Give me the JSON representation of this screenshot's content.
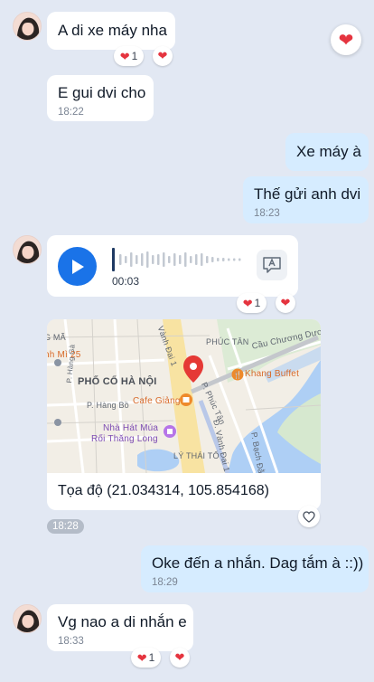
{
  "messages": {
    "m1": {
      "text": "A di xe máy nha",
      "reaction_count": "1"
    },
    "m2": {
      "text": "E gui dvi cho",
      "time": "18:22"
    },
    "m3": {
      "text": "Xe máy à"
    },
    "m4": {
      "text": "Thế gửi anh dvi",
      "time": "18:23"
    },
    "voice": {
      "duration": "00:03",
      "reaction_count": "1"
    },
    "location": {
      "caption": "Tọa độ (21.034314, 105.854168)",
      "time": "18:28"
    },
    "m5": {
      "text": "Oke đến a nhắn. Dag tắm à ::))",
      "time": "18:29"
    },
    "m6": {
      "text": "Vg nao a di nhắn e",
      "time": "18:33",
      "reaction_count": "1"
    }
  },
  "map": {
    "labels": {
      "vanh_dai_1": "Vành Đai 1",
      "phuc_tan": "PHÚC TÂN",
      "cau_chuong_duong": "Cầu Chương Dươn",
      "ma": "G MÃ",
      "mi25": "nh Mì 25",
      "pho_co": "PHỐ CỔ HÀ NỘI",
      "khang_buffet": "Khang Buffet",
      "p_hang_ga": "P. Hàng Gà",
      "p_hang_bo": "P. Hàng Bồ",
      "cafe_giang": "Cafe Giảng",
      "p_phuc_tan": "P. Phúc Tân",
      "nha_hat_1": "Nhà Hát Múa",
      "nha_hat_2": "Rối Thăng Long",
      "d_vanh_dai_1": "Đ. Vành Đai 1",
      "ly_thai_to": "LÝ THÁI TỔ",
      "p_bach_dang": "P. Bạch Đằ"
    }
  },
  "colors": {
    "accent": "#1a73e8",
    "mine_bubble": "#d6ecff",
    "heart": "#e5343f",
    "background": "#e2e8f3"
  }
}
